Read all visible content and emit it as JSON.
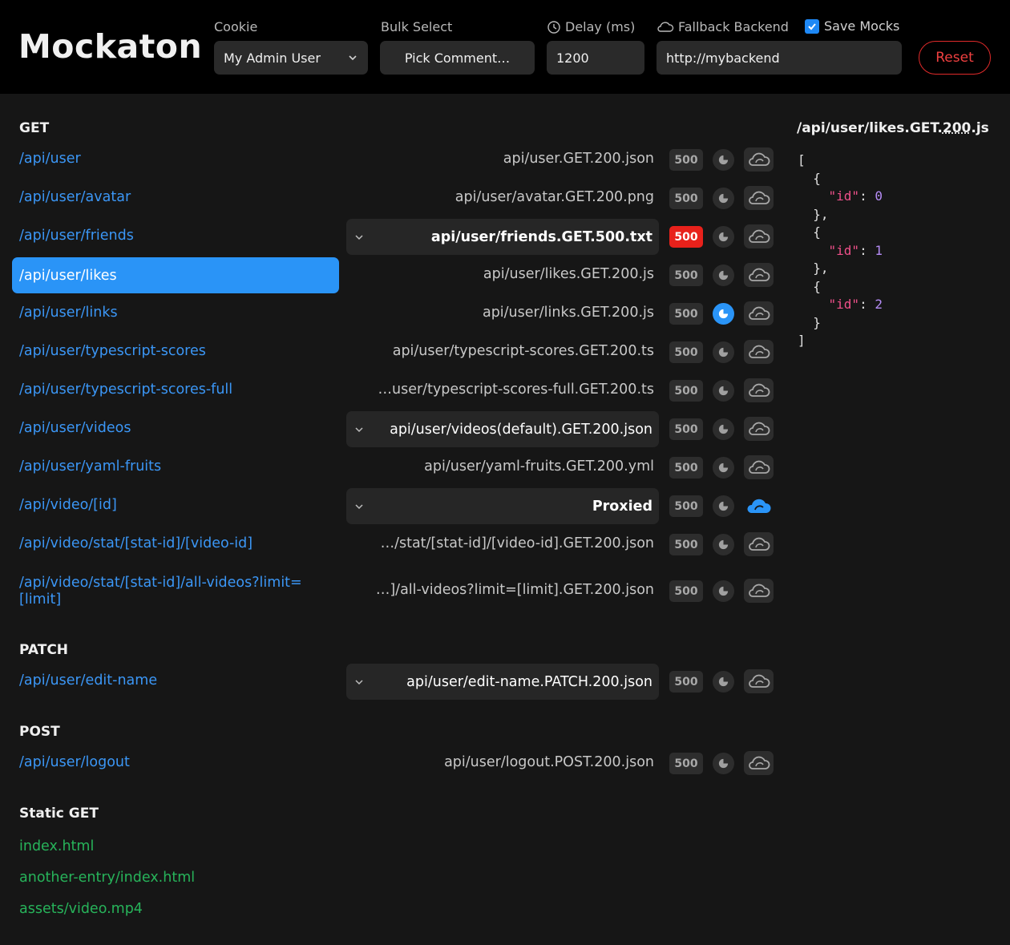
{
  "app": {
    "title": "Mockaton"
  },
  "header": {
    "cookie": {
      "label": "Cookie",
      "value": "My Admin User"
    },
    "bulk_select": {
      "label": "Bulk Select",
      "value": "Pick Comment…"
    },
    "delay": {
      "label": "Delay (ms)",
      "value": "1200"
    },
    "fallback": {
      "label": "Fallback Backend",
      "value": "http://mybackend"
    },
    "save_mocks": {
      "label": "Save Mocks",
      "checked": true
    },
    "reset_label": "Reset"
  },
  "sections": {
    "get": "GET",
    "patch": "PATCH",
    "post": "POST",
    "static": "Static GET"
  },
  "routes": [
    {
      "route": "/api/user",
      "mock": "api/user.GET.200.json",
      "status": "500"
    },
    {
      "route": "/api/user/avatar",
      "mock": "api/user/avatar.GET.200.png",
      "status": "500"
    },
    {
      "route": "/api/user/friends",
      "mock": "api/user/friends.GET.500.txt",
      "status": "500"
    },
    {
      "route": "/api/user/likes",
      "mock": "api/user/likes.GET.200.js",
      "status": "500"
    },
    {
      "route": "/api/user/links",
      "mock": "api/user/links.GET.200.js",
      "status": "500"
    },
    {
      "route": "/api/user/typescript-scores",
      "mock": "api/user/typescript-scores.GET.200.ts",
      "status": "500"
    },
    {
      "route": "/api/user/typescript-scores-full",
      "mock": "…user/typescript-scores-full.GET.200.ts",
      "status": "500"
    },
    {
      "route": "/api/user/videos",
      "mock": "api/user/videos(default).GET.200.json",
      "status": "500"
    },
    {
      "route": "/api/user/yaml-fruits",
      "mock": "api/user/yaml-fruits.GET.200.yml",
      "status": "500"
    },
    {
      "route": "/api/video/[id]",
      "mock": "Proxied",
      "status": "500"
    },
    {
      "route": "/api/video/stat/[stat-id]/[video-id]",
      "mock": "…/stat/[stat-id]/[video-id].GET.200.json",
      "status": "500"
    },
    {
      "route": "/api/video/stat/[stat-id]/all-videos?limit=[limit]",
      "mock": "…]/all-videos?limit=[limit].GET.200.json",
      "status": "500"
    },
    {
      "route": "/api/user/edit-name",
      "mock": "api/user/edit-name.PATCH.200.json",
      "status": "500"
    },
    {
      "route": "/api/user/logout",
      "mock": "api/user/logout.POST.200.json",
      "status": "500"
    }
  ],
  "static_files": [
    "index.html",
    "another-entry/index.html",
    "assets/video.mp4"
  ],
  "preview": {
    "title_prefix": "/api/user/likes.GET.",
    "title_status": "200",
    "title_suffix": ".js",
    "code_bracket_open": "[",
    "code_bracket_close": "]",
    "items": [
      {
        "key": "\"id\"",
        "value": "0"
      },
      {
        "key": "\"id\"",
        "value": "1"
      },
      {
        "key": "\"id\"",
        "value": "2"
      }
    ]
  },
  "colors": {
    "accent": "#2a94f7",
    "link": "#3b96f5",
    "static": "#27b35a",
    "danger": "#e8211b"
  },
  "icons": {
    "clock": "clock-icon",
    "cloud": "cloud-icon",
    "chevron": "chevron-down-icon",
    "check": "check-icon"
  }
}
